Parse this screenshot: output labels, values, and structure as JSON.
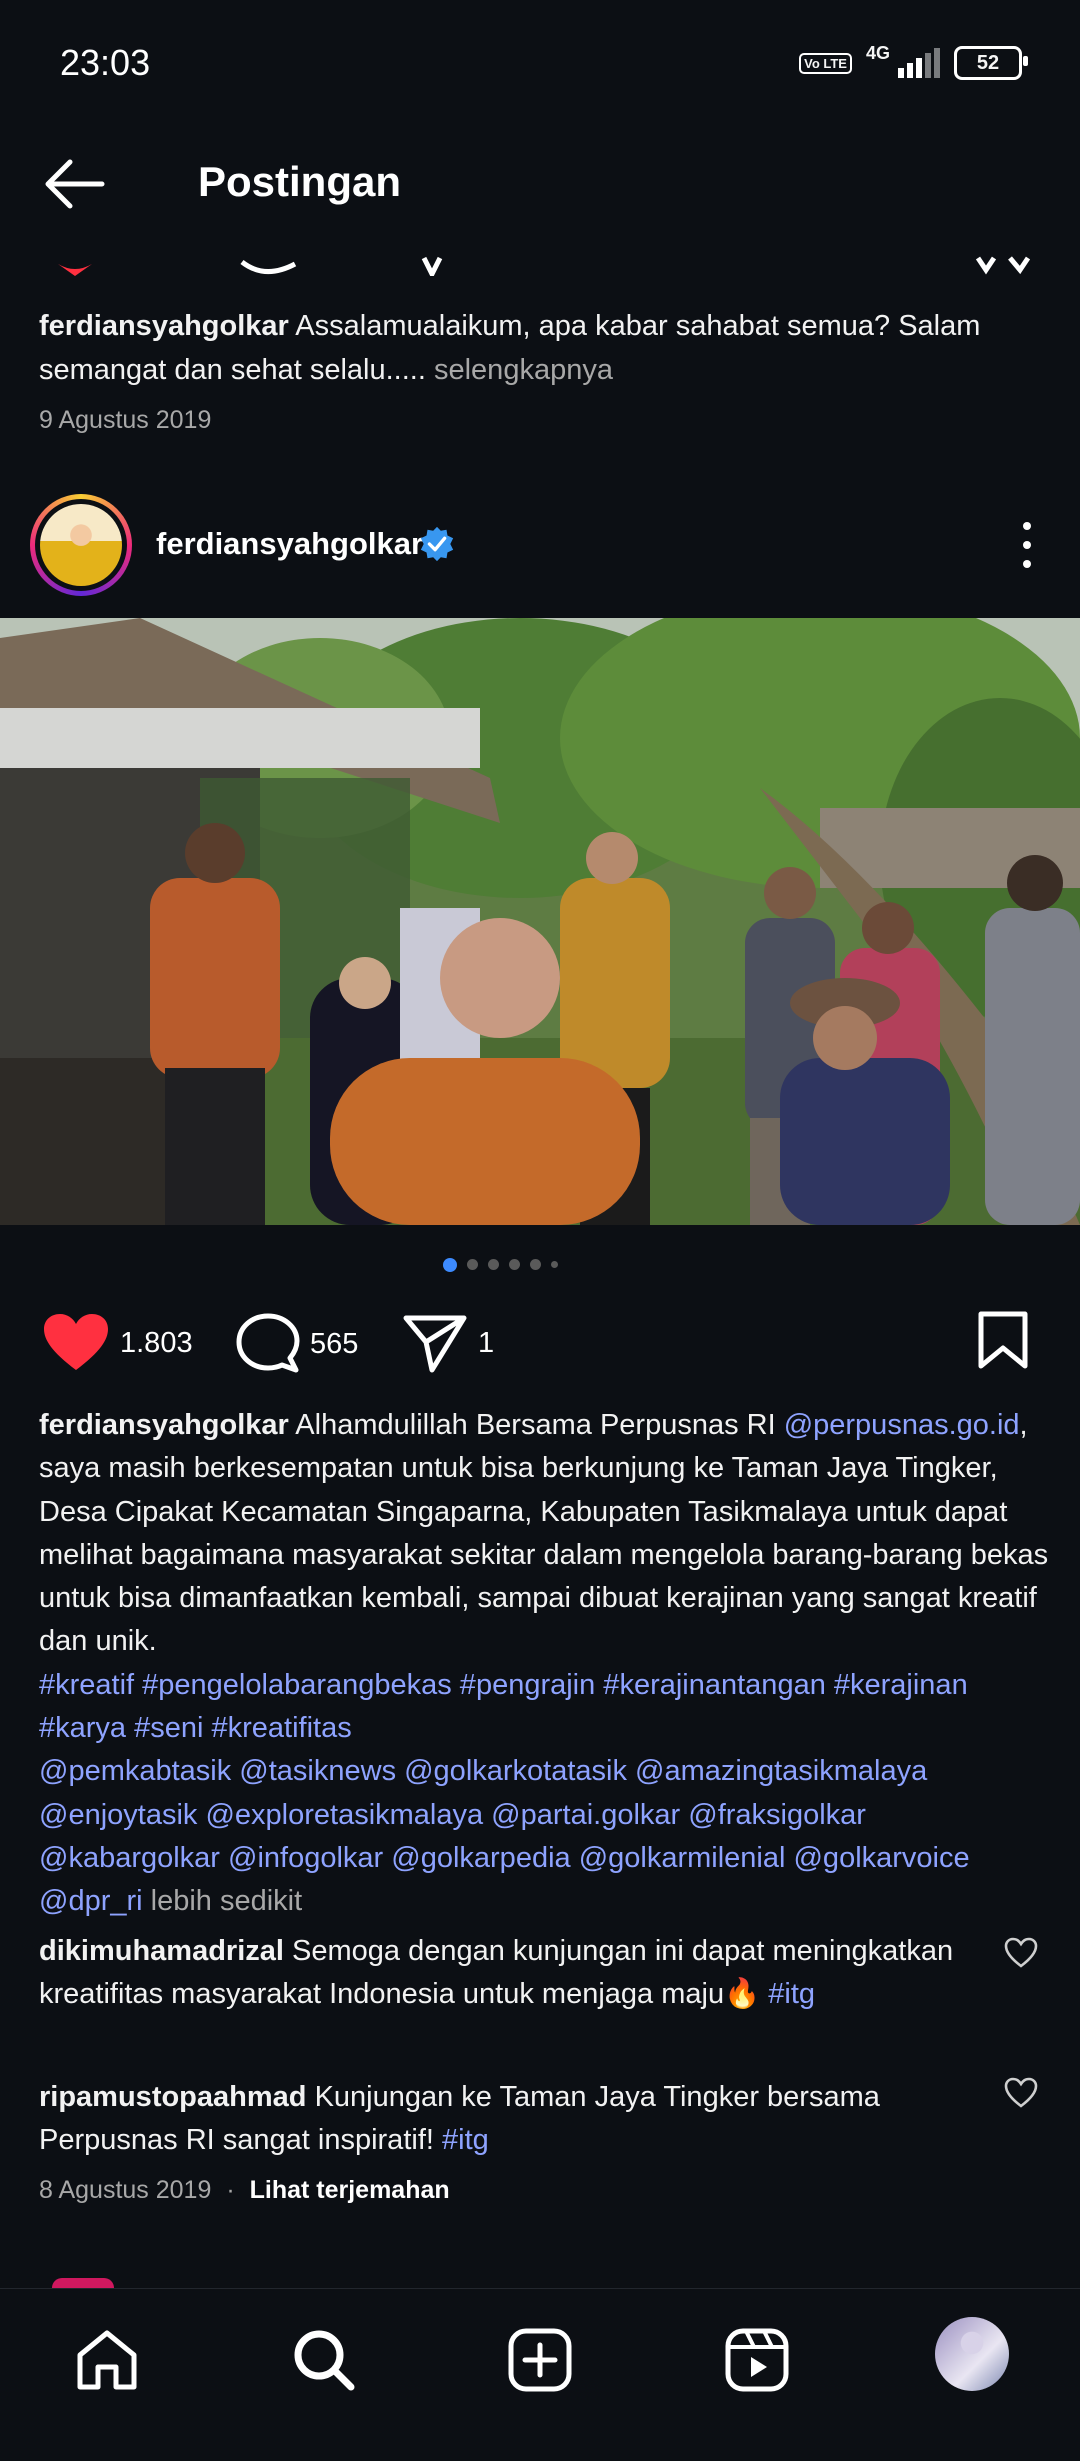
{
  "status_bar": {
    "time": "23:03",
    "volte": "Vo LTE",
    "network": "4G",
    "battery": "52"
  },
  "header": {
    "title": "Postingan"
  },
  "previous_post": {
    "username": "ferdiansyahgolkar",
    "caption": "Assalamualaikum, apa kabar sahabat semua? Salam semangat dan sehat selalu.....",
    "more_label": "selengkapnya",
    "date": "9 Agustus 2019"
  },
  "post": {
    "username": "ferdiansyahgolkar",
    "verified_icon": "verified-badge-icon",
    "carousel": {
      "count": 6,
      "active": 1
    },
    "likes": "1.803",
    "comments": "565",
    "shares": "1",
    "caption_username": "ferdiansyahgolkar",
    "caption_text_1": "Alhamdulillah Bersama Perpusnas RI",
    "caption_mention": "@perpusnas.go.id",
    "caption_text_2": ", saya masih berkesempatan untuk bisa berkunjung ke Taman Jaya Tingker, Desa Cipakat Kecamatan Singaparna, Kabupaten Tasikmalaya untuk dapat melihat bagaimana masyarakat sekitar dalam mengelola barang-barang bekas untuk bisa dimanfaatkan kembali, sampai dibuat kerajinan yang sangat kreatif dan unik.",
    "hashtags": "#kreatif #pengelolabarangbekas #pengrajin #kerajinantangan #kerajinan #karya #seni #kreatifitas",
    "mentions": "@pemkabtasik @tasiknews @golkarkotatasik @amazingtasikmalaya @enjoytasik @exploretasikmalaya @partai.golkar @fraksigolkar @kabargolkar @infogolkar @golkarpedia @golkarmilenial @golkarvoice @dpr_ri",
    "less_label": "lebih sedikit",
    "comment_list": [
      {
        "username": "dikimuhamadrizal",
        "text": "Semoga dengan kunjungan ini dapat meningkatkan kreatifitas masyarakat Indonesia untuk menjaga maju🔥",
        "tag": "#itg"
      },
      {
        "username": "ripamustopaahmad",
        "text": "Kunjungan ke Taman Jaya Tingker bersama Perpusnas RI sangat inspiratif!",
        "tag": "#itg"
      }
    ],
    "date": "8 Agustus 2019",
    "separator": "·",
    "translate_label": "Lihat terjemahan"
  },
  "colors": {
    "background": "#0c0f14",
    "like": "#ff3040",
    "link": "#8ea3ff",
    "verified": "#3897f0",
    "carousel_active": "#3d8bff"
  },
  "nav_icons": [
    "home-icon",
    "search-icon",
    "create-post-icon",
    "reels-icon",
    "profile-avatar"
  ]
}
